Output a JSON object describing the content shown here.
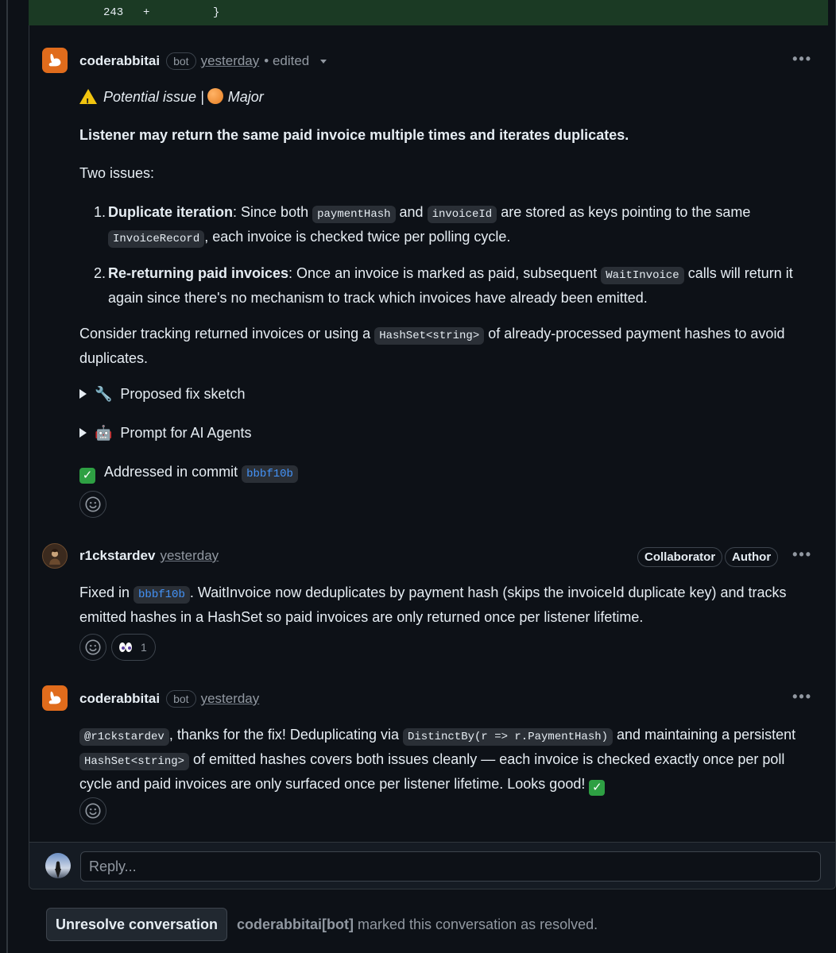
{
  "diff": {
    "line_number": "243",
    "sign": "+",
    "code": "}"
  },
  "comments": [
    {
      "author": "coderabbitai",
      "badge": "bot",
      "time": "yesterday",
      "edited": "• edited",
      "label_issue": "Potential issue",
      "label_sep": "|",
      "label_severity": "Major",
      "title": "Listener may return the same paid invoice multiple times and iterates duplicates.",
      "intro": "Two issues:",
      "items": [
        {
          "num": "1.",
          "title": "Duplicate iteration",
          "t1": ": Since both ",
          "c1": "paymentHash",
          "t2": " and ",
          "c2": "invoiceId",
          "t3": " are stored as keys pointing to the same ",
          "c3": "InvoiceRecord",
          "t4": ", each invoice is checked twice per polling cycle."
        },
        {
          "num": "2.",
          "title": "Re-returning paid invoices",
          "t1": ": Once an invoice is marked as paid, subsequent ",
          "c1": "WaitInvoice",
          "t2": " calls will return it again since there's no mechanism to track which invoices have already been emitted."
        }
      ],
      "consider_1": "Consider tracking returned invoices or using a ",
      "consider_code": "HashSet<string>",
      "consider_2": " of already-processed payment hashes to avoid duplicates.",
      "details": [
        {
          "icon": "🔧",
          "label": "Proposed fix sketch"
        },
        {
          "icon": "🤖",
          "label": "Prompt for AI Agents"
        }
      ],
      "addressed_text": "Addressed in commit",
      "addressed_commit": "bbbf10b"
    },
    {
      "author": "r1ckstardev",
      "time": "yesterday",
      "badges": [
        "Collaborator",
        "Author"
      ],
      "t1": "Fixed in ",
      "commit": "bbbf10b",
      "t2": ". WaitInvoice now deduplicates by payment hash (skips the invoiceId duplicate key) and tracks emitted hashes in a HashSet so paid invoices are only returned once per listener lifetime.",
      "reaction_count": "1"
    },
    {
      "author": "coderabbitai",
      "badge": "bot",
      "time": "yesterday",
      "mention": "@r1ckstardev",
      "t1": ", thanks for the fix! Deduplicating via ",
      "c1": "DistinctBy(r => r.PaymentHash)",
      "t2": " and maintaining a persistent ",
      "c2": "HashSet<string>",
      "t3": " of emitted hashes covers both issues cleanly — each invoice is checked exactly once per poll cycle and paid invoices are only surfaced once per listener lifetime. Looks good! "
    }
  ],
  "reply": {
    "placeholder": "Reply..."
  },
  "footer": {
    "unresolve_label": "Unresolve conversation",
    "resolved_by": "coderabbitai[bot]",
    "resolved_text": " marked this conversation as resolved."
  },
  "colors": {
    "rabbit_orange": "#e06c1c",
    "link_blue": "#4493f8",
    "diff_add_bg": "#1b3a24"
  }
}
